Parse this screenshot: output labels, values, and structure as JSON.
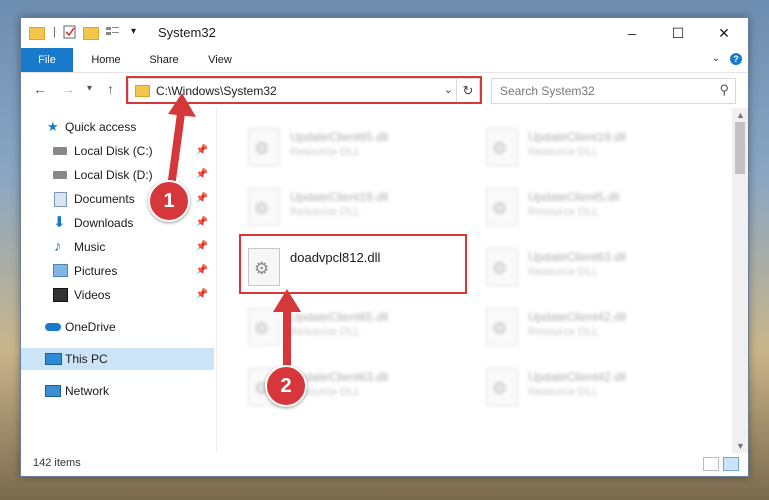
{
  "window": {
    "title": "System32",
    "controls": {
      "minimize": "–",
      "maximize": "☐",
      "close": "✕"
    }
  },
  "ribbon": {
    "tabs": [
      "File",
      "Home",
      "Share",
      "View"
    ],
    "help": "?"
  },
  "address": {
    "path": "C:\\Windows\\System32",
    "search_placeholder": "Search System32"
  },
  "nav": {
    "items": [
      {
        "label": "Quick access",
        "icon": "star-icon",
        "pinned": false
      },
      {
        "label": "Local Disk (C:)",
        "icon": "drive-icon",
        "pinned": true
      },
      {
        "label": "Local Disk (D:)",
        "icon": "drive-icon",
        "pinned": true
      },
      {
        "label": "Documents",
        "icon": "documents-icon",
        "pinned": true
      },
      {
        "label": "Downloads",
        "icon": "download-icon",
        "pinned": true
      },
      {
        "label": "Music",
        "icon": "music-icon",
        "pinned": true
      },
      {
        "label": "Pictures",
        "icon": "pictures-icon",
        "pinned": true
      },
      {
        "label": "Videos",
        "icon": "videos-icon",
        "pinned": true
      },
      {
        "label": "OneDrive",
        "icon": "cloud-icon",
        "pinned": false
      },
      {
        "label": "This PC",
        "icon": "computer-icon",
        "pinned": false,
        "selected": true
      },
      {
        "label": "Network",
        "icon": "network-icon",
        "pinned": false
      }
    ]
  },
  "files": {
    "left": [
      {
        "name": "UpdateClient65.dll",
        "type": "Resource DLL"
      },
      {
        "name": "UpdateClient19.dll",
        "type": "Resource DLL"
      },
      {
        "name": "doadvpcl812.dll",
        "type": ""
      },
      {
        "name": "UpdateClient65.dll",
        "type": "Resource DLL"
      },
      {
        "name": "UpdateClient63.dll",
        "type": "Resource DLL"
      }
    ],
    "right": [
      {
        "name": "UpdateClient19.dll",
        "type": "Resource DLL"
      },
      {
        "name": "UpdateClient5.dll",
        "type": "Resource DLL"
      },
      {
        "name": "UpdateClient63.dll",
        "type": "Resource DLL"
      },
      {
        "name": "UpdateClient42.dll",
        "type": "Resource DLL"
      },
      {
        "name": "UpdateClient42.dll",
        "type": "Resource DLL"
      }
    ]
  },
  "status": {
    "item_count": "142 items"
  },
  "callouts": {
    "one": "1",
    "two": "2"
  },
  "colors": {
    "accent": "#1979ca",
    "highlight": "#d6373a",
    "selected": "#cce4f7"
  }
}
